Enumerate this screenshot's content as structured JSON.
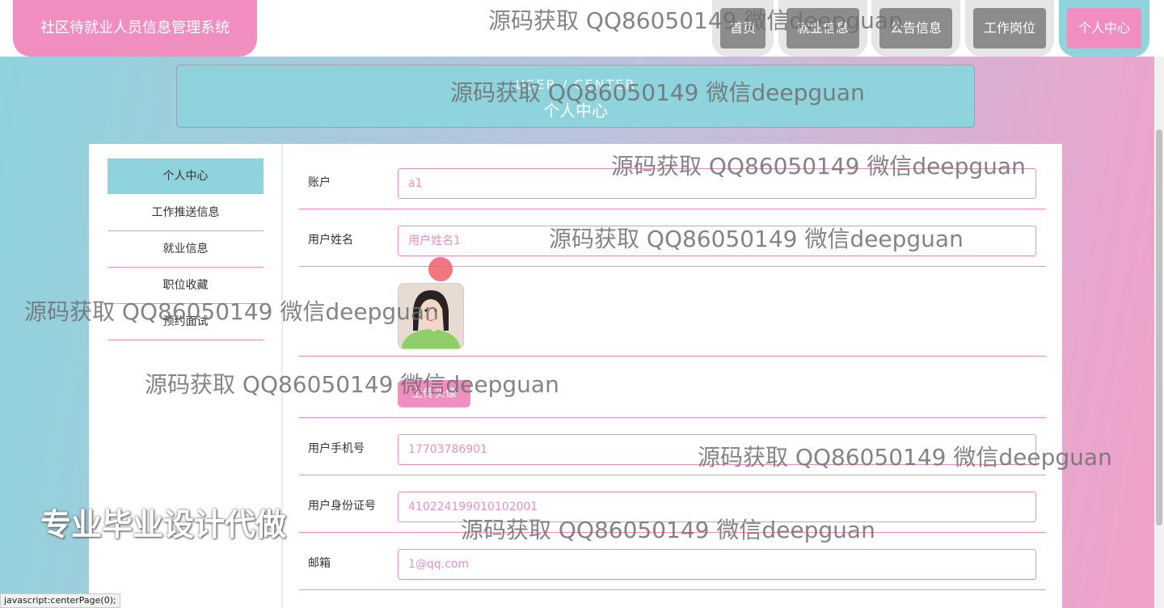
{
  "header": {
    "brand": "社区待就业人员信息管理系统",
    "nav": [
      {
        "label": "首页",
        "active": false
      },
      {
        "label": "就业信息",
        "active": false
      },
      {
        "label": "公告信息",
        "active": false
      },
      {
        "label": "工作岗位",
        "active": false
      },
      {
        "label": "个人中心",
        "active": true
      }
    ]
  },
  "banner": {
    "en": "USER / CENTER",
    "title": "个人中心"
  },
  "sidebar": {
    "items": [
      {
        "label": "个人中心",
        "active": true
      },
      {
        "label": "工作推送信息",
        "active": false
      },
      {
        "label": "就业信息",
        "active": false
      },
      {
        "label": "职位收藏",
        "active": false
      },
      {
        "label": "预约面试",
        "active": false
      }
    ]
  },
  "form": {
    "account_label": "账户",
    "account_value": "a1",
    "name_label": "用户姓名",
    "name_value": "用户姓名1",
    "upload_label": "上传头像",
    "phone_label": "用户手机号",
    "phone_value": "17703786901",
    "id_label": "用户身份证号",
    "id_value": "410224199010102001",
    "email_label": "邮箱",
    "email_value": "1@qq.com"
  },
  "watermark": "源码获取 QQ86050149 微信deepguan",
  "promo": "专业毕业设计代做",
  "status_bar": "javascript:centerPage(0);",
  "colors": {
    "accent_pink": "#f08fbf",
    "accent_teal": "#8fd3dc",
    "nav_gray": "#8c8c8c"
  }
}
